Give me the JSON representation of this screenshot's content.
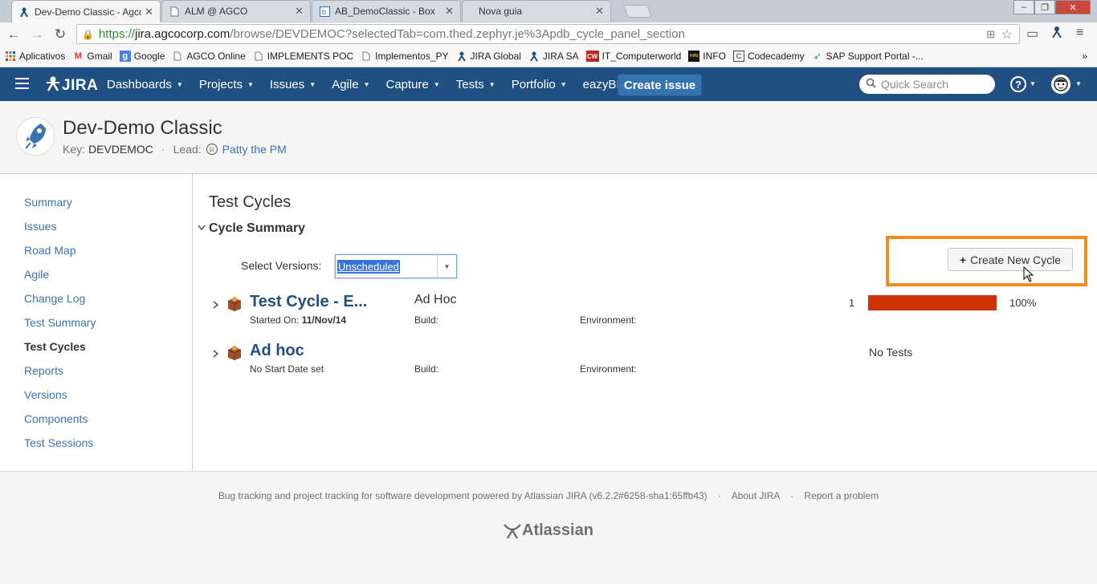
{
  "browser": {
    "tabs": [
      {
        "title": "Dev-Demo Classic - Agco",
        "active": true,
        "icon": "jira-favicon"
      },
      {
        "title": "ALM @ AGCO",
        "active": false,
        "icon": "page-icon"
      },
      {
        "title": "AB_DemoClassic - Box",
        "active": false,
        "icon": "box-icon"
      },
      {
        "title": "Nova guia",
        "active": false,
        "icon": "blank"
      }
    ],
    "url_scheme": "https://",
    "url_domain": "jira.agcocorp.com",
    "url_path": "/browse/DEVDEMOC?selectedTab=com.thed.zephyr.je%3Apdb_cycle_panel_section",
    "bookmarks": [
      {
        "label": "Aplicativos",
        "icon": "apps-grid-icon"
      },
      {
        "label": "Gmail",
        "icon": "gmail-icon"
      },
      {
        "label": "Google",
        "icon": "google-icon"
      },
      {
        "label": "AGCO Online",
        "icon": "page-icon"
      },
      {
        "label": "IMPLEMENTS POC",
        "icon": "page-icon"
      },
      {
        "label": "Implementos_PY",
        "icon": "page-icon"
      },
      {
        "label": "JIRA Global",
        "icon": "jira-favicon"
      },
      {
        "label": "JIRA SA",
        "icon": "jira-favicon"
      },
      {
        "label": "IT_Computerworld",
        "icon": "cw-icon"
      },
      {
        "label": "INFO",
        "icon": "info-icon"
      },
      {
        "label": "Codecademy",
        "icon": "codecademy-icon"
      },
      {
        "label": "SAP Support Portal -...",
        "icon": "sap-icon"
      }
    ],
    "bookmarks_more": "»"
  },
  "jira_header": {
    "logo_text": "JIRA",
    "nav": [
      {
        "label": "Dashboards",
        "dropdown": true
      },
      {
        "label": "Projects",
        "dropdown": true
      },
      {
        "label": "Issues",
        "dropdown": true
      },
      {
        "label": "Agile",
        "dropdown": true
      },
      {
        "label": "Capture",
        "dropdown": true
      },
      {
        "label": "Tests",
        "dropdown": true
      },
      {
        "label": "Portfolio",
        "dropdown": true
      },
      {
        "label": "eazyBI",
        "dropdown": false
      }
    ],
    "create_button": "Create issue",
    "search_placeholder": "Quick Search",
    "help_symbol": "?",
    "brand_color": "#205081"
  },
  "project": {
    "name": "Dev-Demo Classic",
    "key_label": "Key:",
    "key": "DEVDEMOC",
    "lead_label": "Lead:",
    "lead": "Patty the PM"
  },
  "sidebar": {
    "items": [
      {
        "label": "Summary",
        "active": false
      },
      {
        "label": "Issues",
        "active": false
      },
      {
        "label": "Road Map",
        "active": false
      },
      {
        "label": "Agile",
        "active": false
      },
      {
        "label": "Change Log",
        "active": false
      },
      {
        "label": "Test Summary",
        "active": false
      },
      {
        "label": "Test Cycles",
        "active": true
      },
      {
        "label": "Reports",
        "active": false
      },
      {
        "label": "Versions",
        "active": false
      },
      {
        "label": "Components",
        "active": false
      },
      {
        "label": "Test Sessions",
        "active": false
      }
    ]
  },
  "main": {
    "title": "Test Cycles",
    "section_title": "Cycle Summary",
    "select_versions_label": "Select Versions:",
    "select_versions_value": "Unscheduled",
    "create_cycle_button": "Create New Cycle",
    "highlight_color": "#f28c1c",
    "cycles": [
      {
        "name": "Test Cycle - E...",
        "start_label": "Started On:",
        "start_value": "11/Nov/14",
        "version": "Ad Hoc",
        "build_label": "Build:",
        "environment_label": "Environment:",
        "test_count": "1",
        "progress_fraction": 1.0,
        "progress_color": "#cc3300",
        "percent": "100%"
      },
      {
        "name": "Ad hoc",
        "start_text": "No Start Date set",
        "build_label": "Build:",
        "environment_label": "Environment:",
        "no_tests": "No Tests"
      }
    ]
  },
  "footer": {
    "text": "Bug tracking and project tracking for software development powered by Atlassian JIRA (v6.2.2#6258-sha1:65ffb43)",
    "about": "About JIRA",
    "report": "Report a problem",
    "brand": "Atlassian"
  }
}
